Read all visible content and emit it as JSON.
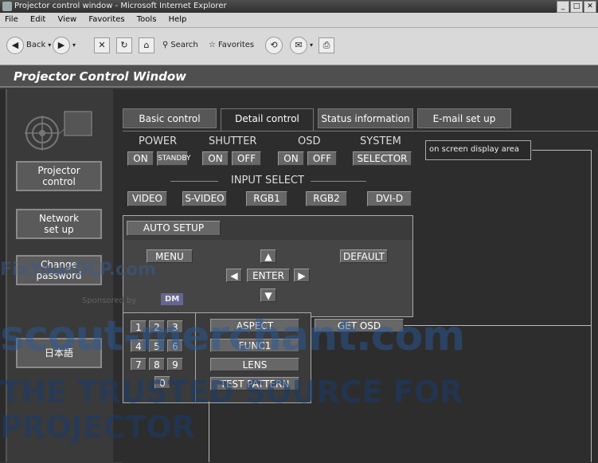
{
  "window": {
    "title": "Projector control window - Microsoft Internet Explorer",
    "controls": [
      "_",
      "□",
      "✕"
    ]
  },
  "menu": [
    "File",
    "Edit",
    "View",
    "Favorites",
    "Tools",
    "Help"
  ],
  "toolbar": {
    "back": "Back",
    "search": "Search",
    "favorites": "Favorites"
  },
  "app_title": "Projector Control Window",
  "nav": {
    "projector_control": "Projector control",
    "network_setup": "Network set up",
    "change_password": "Change password",
    "japanese": "日本語"
  },
  "tabs": [
    "Basic control",
    "Detail control",
    "Status information",
    "E-mail set up"
  ],
  "groups": {
    "power": {
      "label": "POWER",
      "on": "ON",
      "standby": "STANDBY"
    },
    "shutter": {
      "label": "SHUTTER",
      "on": "ON",
      "off": "OFF"
    },
    "osd": {
      "label": "OSD",
      "on": "ON",
      "off": "OFF"
    },
    "system": {
      "label": "SYSTEM",
      "selector": "SELECTOR"
    }
  },
  "input_select": {
    "label": "INPUT SELECT",
    "options": [
      "VIDEO",
      "S-VIDEO",
      "RGB1",
      "RGB2",
      "DVI-D"
    ]
  },
  "osd_area": "on screen display area",
  "controls": {
    "auto_setup": "AUTO SETUP",
    "menu": "MENU",
    "default": "DEFAULT",
    "enter": "ENTER",
    "up": "▲",
    "down": "▼",
    "left": "◀",
    "right": "▶",
    "aspect": "ASPECT",
    "func1": "FUNC1",
    "lens": "LENS",
    "test_pattern": "TEST PATTERN",
    "get_osd": "GET OSD"
  },
  "keypad": [
    "1",
    "2",
    "3",
    "4",
    "5",
    "6",
    "7",
    "8",
    "9",
    "0"
  ],
  "watermarks": {
    "fixyourdlp": "FixYourDLP.com",
    "sponsored": "Sponsored by",
    "dm": "DM",
    "scout": "scout-merchant.com",
    "trusted": "THE TRUSTED SOURCE FOR PROJECTOR"
  }
}
